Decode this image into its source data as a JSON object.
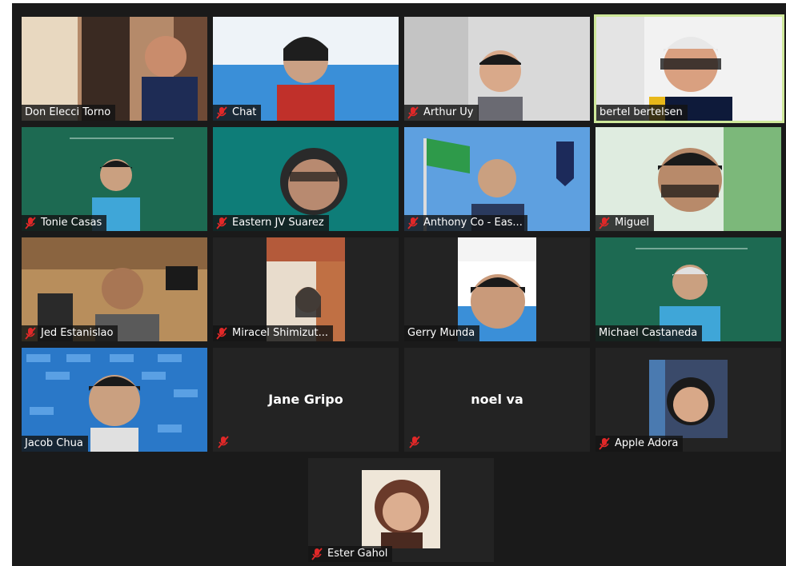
{
  "meeting": {
    "participants": [
      {
        "name": "Don Elecci Torno",
        "muted": false,
        "video": true
      },
      {
        "name": "Chat",
        "muted": true,
        "video": true
      },
      {
        "name": "Arthur Uy",
        "muted": true,
        "video": true
      },
      {
        "name": "bertel bertelsen",
        "muted": false,
        "video": true,
        "active_speaker": true
      },
      {
        "name": "Tonie Casas",
        "muted": true,
        "video": true
      },
      {
        "name": "Eastern JV Suarez",
        "muted": true,
        "video": true
      },
      {
        "name": "Anthony Co - Eas...",
        "muted": true,
        "video": true
      },
      {
        "name": "Miguel",
        "muted": true,
        "video": true
      },
      {
        "name": "Jed Estanislao",
        "muted": true,
        "video": true
      },
      {
        "name": "Miracel Shimizut...",
        "muted": true,
        "video": true
      },
      {
        "name": "Gerry Munda",
        "muted": false,
        "video": true
      },
      {
        "name": "Michael Castaneda",
        "muted": false,
        "video": true
      },
      {
        "name": "Jacob Chua",
        "muted": false,
        "video": true
      },
      {
        "name": "Jane Gripo",
        "muted": true,
        "video": false
      },
      {
        "name": "noel va",
        "muted": true,
        "video": false
      },
      {
        "name": "Apple Adora",
        "muted": true,
        "video": true
      },
      {
        "name": "Ester Gahol",
        "muted": true,
        "video": true
      }
    ]
  },
  "colors": {
    "background": "#1a1a1a",
    "tile": "#232323",
    "active_border": "#cfe89a",
    "muted_icon": "#e02828"
  },
  "icons": {
    "muted": "mic-muted-icon"
  }
}
